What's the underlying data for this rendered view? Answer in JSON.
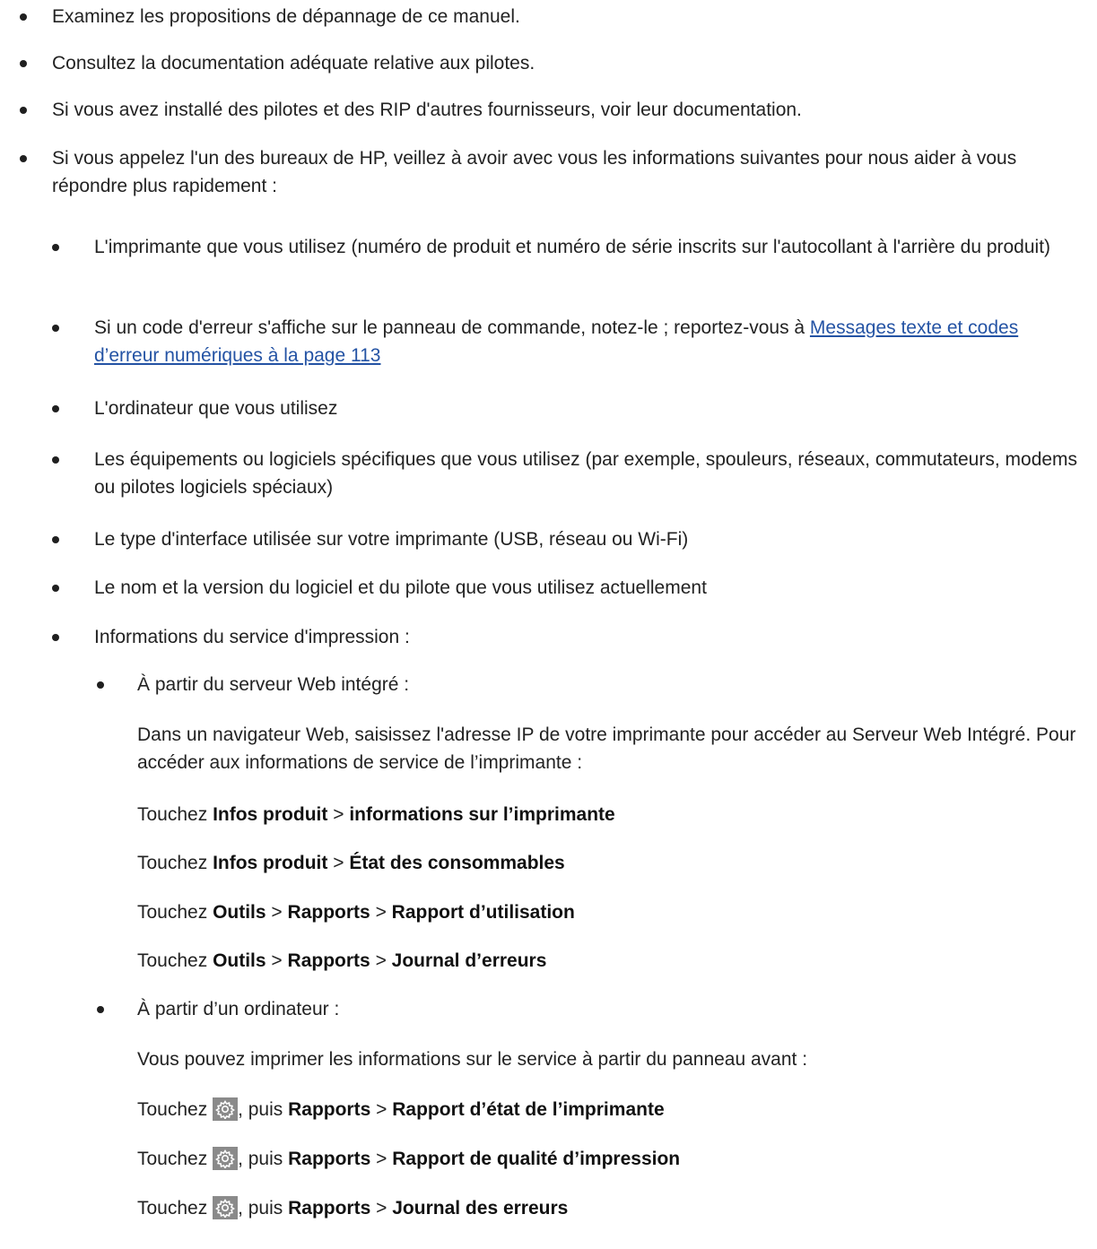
{
  "items": [
    {
      "text": "Examinez les propositions de dépannage de ce manuel."
    },
    {
      "text": "Consultez la documentation adéquate relative aux pilotes."
    },
    {
      "text": "Si vous avez installé des pilotes et des RIP d'autres fournisseurs, voir leur documentation."
    },
    {
      "text": "Si vous appelez l'un des bureaux de HP, veillez à avoir avec vous les informations suivantes pour nous aider à vous répondre plus rapidement :"
    }
  ],
  "subitems": [
    {
      "text": "L'imprimante que vous utilisez (numéro de produit et numéro de série inscrits sur l'autocollant à l'arrière du produit)"
    },
    {
      "text": "Si un code d'erreur s'affiche sur le panneau de commande, notez-le ; reportez-vous à ",
      "link": "Messages texte et codes d’erreur numériques à la page 113"
    },
    {
      "text": "L'ordinateur que vous utilisez"
    },
    {
      "text": "Les équipements ou logiciels spécifiques que vous utilisez (par exemple, spouleurs, réseaux, commutateurs, modems ou pilotes logiciels spéciaux)"
    },
    {
      "text": "Le type d'interface utilisée sur votre imprimante (USB, réseau ou Wi-Fi)"
    },
    {
      "text": "Le nom et la version du logiciel et du pilote que vous utilisez actuellement"
    },
    {
      "text": "Informations du service d'impression :"
    }
  ],
  "web_server": {
    "label": "À partir du serveur Web intégré :",
    "description": "Dans un navigateur Web, saisissez l'adresse IP de votre imprimante pour accéder au Serveur Web Intégré. Pour accéder aux informations de service de l’imprimante :",
    "touchez": "Touchez",
    "sep": ">",
    "steps": [
      {
        "a": "Infos produit",
        "b": "informations sur l’imprimante"
      },
      {
        "a": "Infos produit",
        "b": "État des consommables"
      },
      {
        "a": "Outils",
        "b": "Rapports",
        "c": "Rapport d’utilisation"
      },
      {
        "a": "Outils",
        "b": "Rapports",
        "c": "Journal d’erreurs"
      }
    ]
  },
  "computer": {
    "label": "À partir d’un ordinateur :",
    "description": "Vous pouvez imprimer les informations sur le service à partir du panneau avant :",
    "touchez": "Touchez",
    "puis": ", puis",
    "sep": ">",
    "icon": "gear-icon",
    "steps": [
      {
        "a": "Rapports",
        "b": "Rapport d’état de l’imprimante"
      },
      {
        "a": "Rapports",
        "b": "Rapport de qualité d’impression"
      },
      {
        "a": "Rapports",
        "b": "Journal des erreurs"
      }
    ]
  },
  "colors": {
    "link": "#2453a4",
    "icon_bg": "#8a8a8a"
  }
}
